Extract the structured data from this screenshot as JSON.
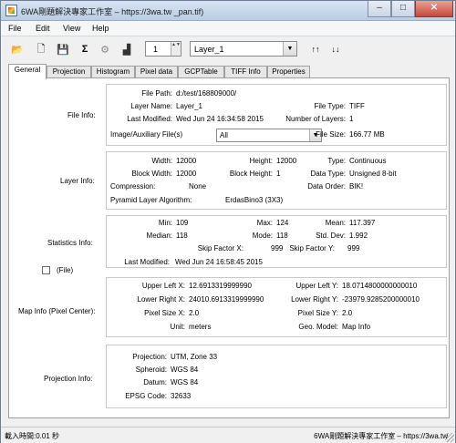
{
  "window": {
    "title": "6WA剛題解決專家工作室 – https://3wa.tw  _pan.tif)",
    "min_glyph": "–",
    "max_glyph": "□",
    "close_glyph": "✕"
  },
  "menu": [
    "File",
    "Edit",
    "View",
    "Help"
  ],
  "toolbar": {
    "icons": [
      "open-folder-icon",
      "new-document-icon",
      "save-disk-icon",
      "sigma-icon",
      "settings-gear-icon",
      "histogram-icon",
      "sort-ascending-icon",
      "sort-descending-icon"
    ],
    "glyphs": {
      "open": "📂",
      "new": "🗋",
      "save": "💾",
      "sigma": "Σ",
      "gear": "⚙",
      "histogram": "▟",
      "sort_asc": "↑↑",
      "sort_desc": "↓↓"
    },
    "band_number": "1",
    "spin_glyph": "▲▼",
    "dropdown_glyph": "▼",
    "layer_selected": "Layer_1"
  },
  "tabs": [
    "General",
    "Projection",
    "Histogram",
    "Pixel data",
    "GCPTable",
    "TIFF Info",
    "Properties"
  ],
  "file_info": {
    "section": "File Info:",
    "file_path_label": "File Path:",
    "file_path": "d:/test/168809000/",
    "layer_name_label": "Layer Name:",
    "layer_name": "Layer_1",
    "file_type_label": "File Type:",
    "file_type": "TIFF",
    "last_modified_label": "Last Modified:",
    "last_modified": "Wed Jun 24 16:34:58 2015",
    "num_layers_label": "Number of Layers:",
    "num_layers": "1",
    "aux_label": "Image/Auxiliary File(s)",
    "aux_selected": "All",
    "file_size_label": "File Size:",
    "file_size": "166.77 MB"
  },
  "layer_info": {
    "section": "Layer Info:",
    "width_label": "Width:",
    "width": "12000",
    "height_label": "Height:",
    "height": "12000",
    "type_label": "Type:",
    "type": "Continuous",
    "block_width_label": "Block Width:",
    "block_width": "12000",
    "block_height_label": "Block Height:",
    "block_height": "1",
    "data_type_label": "Data Type:",
    "data_type": "Unsigned 8-bit",
    "compression_label": "Compression:",
    "compression": "None",
    "data_order_label": "Data Order:",
    "data_order": "BIK!",
    "pyramid_label": "Pyramid Layer Algorithm:",
    "pyramid": "ErdasBino3 (3X3)"
  },
  "stats_info": {
    "section": "Statistics Info:",
    "min_label": "Min:",
    "min": "109",
    "max_label": "Max:",
    "max": "124",
    "mean_label": "Mean:",
    "mean": "117.397",
    "median_label": "Median:",
    "median": "118",
    "mode_label": "Mode:",
    "mode": "118",
    "std_label": "Std. Dev:",
    "std": "1.992",
    "skip_x_label": "Skip Factor X:",
    "skip_x": "999",
    "skip_y_label": "Skip Factor Y:",
    "skip_y": "999",
    "last_modified_label": "Last Modified:",
    "last_modified": "Wed Jun 24 16:58:45 2015",
    "file_checkbox_label": "(File)"
  },
  "map_info": {
    "section": "Map Info (Pixel Center):",
    "upper_left_x_label": "Upper Left X:",
    "upper_left_x": "12.6913319999990",
    "upper_left_y_label": "Upper Left Y:",
    "upper_left_y": "18.0714800000000010",
    "lower_right_x_label": "Lower Right X:",
    "lower_right_x": "24010.6913319999990",
    "lower_right_y_label": "Lower Right Y:",
    "lower_right_y": "-23979.9285200000010",
    "pixel_size_x_label": "Pixel Size X:",
    "pixel_size_x": "2.0",
    "pixel_size_y_label": "Pixel Size Y:",
    "pixel_size_y": "2.0",
    "unit_label": "Unit:",
    "unit": "meters",
    "geo_model_label": "Geo. Model:",
    "geo_model": "Map Info"
  },
  "proj_info": {
    "section": "Projection Info:",
    "projection_label": "Projection:",
    "projection": "UTM, Zone 33",
    "spheroid_label": "Spheroid:",
    "spheroid": "WGS 84",
    "datum_label": "Datum:",
    "datum": "WGS 84",
    "epsg_label": "EPSG Code:",
    "epsg": "32633"
  },
  "status": {
    "left": "載入時間:0.01 秒",
    "right": "6WA剛題解決專家工作室 – https://3wa.tw"
  }
}
